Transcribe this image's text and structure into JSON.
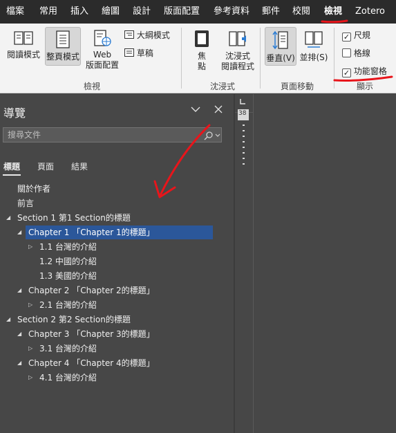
{
  "menu": {
    "tabs": [
      "檔案",
      "常用",
      "插入",
      "繪圖",
      "設計",
      "版面配置",
      "參考資料",
      "郵件",
      "校閱",
      "檢視",
      "Zotero"
    ],
    "active_tab": "檢視"
  },
  "ribbon": {
    "views_group": {
      "read_mode": "閱讀模式",
      "print_layout": "整頁模式",
      "web_layout_line1": "Web",
      "web_layout_line2": "版面配置",
      "outline": "大綱模式",
      "draft": "草稿",
      "label": "檢視"
    },
    "immersive_group": {
      "focus_line1": "焦",
      "focus_line2": "點",
      "immersive_reader_line1": "沈浸式",
      "immersive_reader_line2": "閱讀程式",
      "label": "沈浸式"
    },
    "page_movement_group": {
      "vertical": "垂直(V)",
      "side_by_side": "並排(S)",
      "label": "頁面移動"
    },
    "show_group": {
      "ruler": "尺規",
      "ruler_checked": true,
      "gridlines": "格線",
      "gridlines_checked": false,
      "nav_pane": "功能窗格",
      "nav_pane_checked": true,
      "label": "顯示"
    }
  },
  "nav_pane": {
    "title": "導覽",
    "search_placeholder": "搜尋文件",
    "tabs": [
      "標題",
      "頁面",
      "結果"
    ],
    "active_tab": "標題",
    "headings": [
      {
        "text": "關於作者",
        "level": 0,
        "expander": "none"
      },
      {
        "text": "前言",
        "level": 0,
        "expander": "none"
      },
      {
        "text": "Section 1 第1 Section的標題",
        "level": 0,
        "expander": "expanded"
      },
      {
        "text": "Chapter 1 「Chapter 1的標題」",
        "level": 1,
        "expander": "expanded",
        "selected": true
      },
      {
        "text": "1.1 台灣的介紹",
        "level": 2,
        "expander": "collapsed"
      },
      {
        "text": "1.2 中國的介紹",
        "level": 2,
        "expander": "none"
      },
      {
        "text": "1.3 美國的介紹",
        "level": 2,
        "expander": "none"
      },
      {
        "text": "Chapter 2 「Chapter 2的標題」",
        "level": 1,
        "expander": "expanded"
      },
      {
        "text": "2.1 台灣的介紹",
        "level": 2,
        "expander": "collapsed"
      },
      {
        "text": "Section 2 第2 Section的標題",
        "level": 0,
        "expander": "expanded"
      },
      {
        "text": "Chapter 3 「Chapter 3的標題」",
        "level": 1,
        "expander": "expanded"
      },
      {
        "text": "3.1 台灣的介紹",
        "level": 2,
        "expander": "collapsed"
      },
      {
        "text": "Chapter 4 「Chapter 4的標題」",
        "level": 1,
        "expander": "expanded"
      },
      {
        "text": "4.1 台灣的介紹",
        "level": 2,
        "expander": "collapsed"
      }
    ]
  },
  "ruler": {
    "value": "38"
  },
  "colors": {
    "annotation": "#e8151b",
    "selection": "#2b579a",
    "menubar": "#2b2b2b",
    "ribbon": "#f3f3f3"
  },
  "icons": {
    "close": "close-icon",
    "options": "chevron-down-icon",
    "search": "search-icon"
  }
}
